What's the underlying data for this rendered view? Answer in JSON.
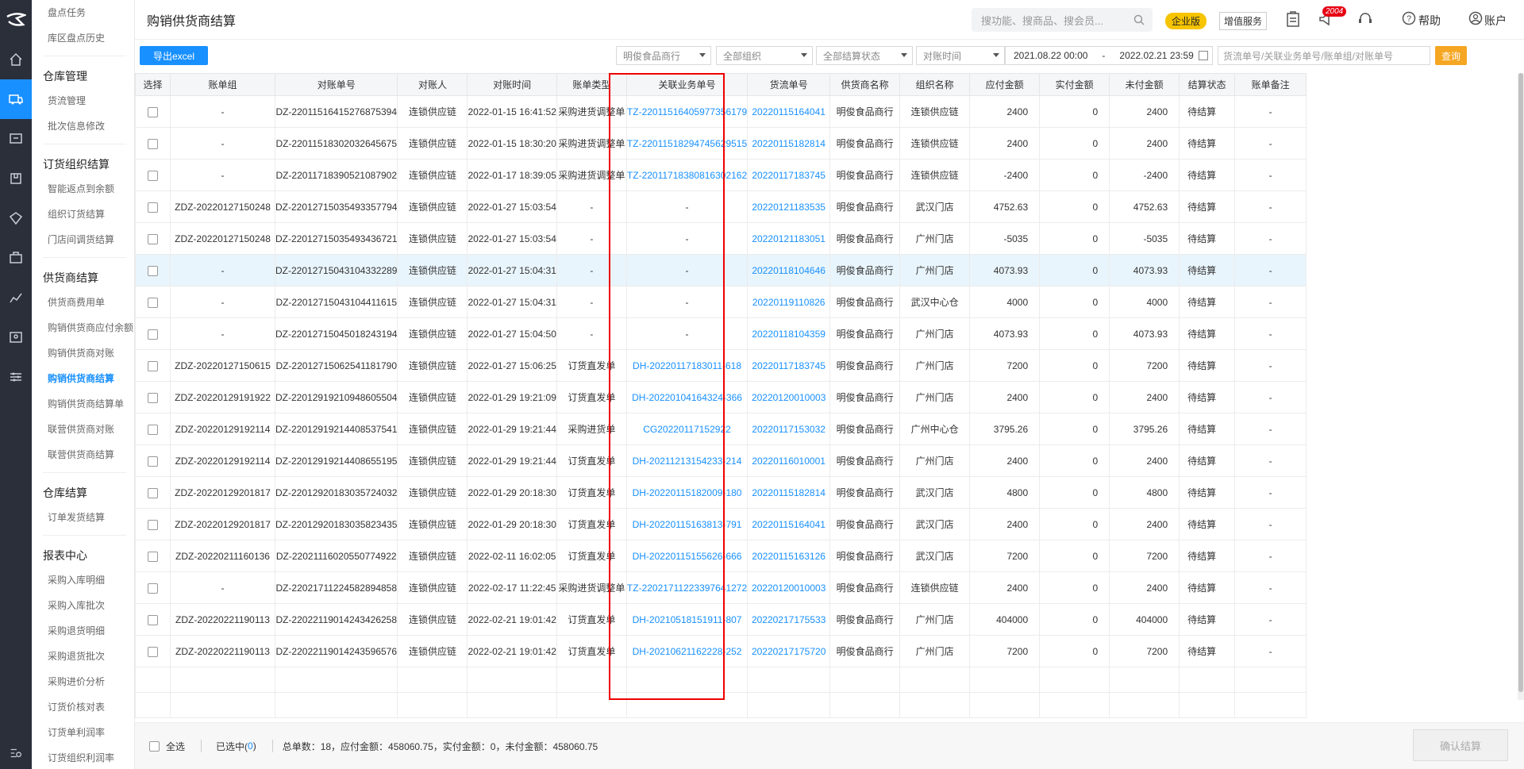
{
  "sidebar": {
    "items": [
      {
        "type": "item",
        "label": "盘点任务"
      },
      {
        "type": "item",
        "label": "库区盘点历史"
      },
      {
        "type": "group",
        "label": "仓库管理"
      },
      {
        "type": "item",
        "label": "货流管理"
      },
      {
        "type": "item",
        "label": "批次信息修改"
      },
      {
        "type": "group",
        "label": "订货组织结算"
      },
      {
        "type": "item",
        "label": "智能返点到余额"
      },
      {
        "type": "item",
        "label": "组织订货结算"
      },
      {
        "type": "item",
        "label": "门店间调货结算"
      },
      {
        "type": "group",
        "label": "供货商结算"
      },
      {
        "type": "item",
        "label": "供货商费用单"
      },
      {
        "type": "item",
        "label": "购销供货商应付余额",
        "wrap": true
      },
      {
        "type": "item",
        "label": "购销供货商对账"
      },
      {
        "type": "item",
        "label": "购销供货商结算",
        "active": true
      },
      {
        "type": "item",
        "label": "购销供货商结算单"
      },
      {
        "type": "item",
        "label": "联营供货商对账"
      },
      {
        "type": "item",
        "label": "联营供货商结算"
      },
      {
        "type": "group",
        "label": "仓库结算"
      },
      {
        "type": "item",
        "label": "订单发货结算"
      },
      {
        "type": "group",
        "label": "报表中心"
      },
      {
        "type": "item",
        "label": "采购入库明细"
      },
      {
        "type": "item",
        "label": "采购入库批次"
      },
      {
        "type": "item",
        "label": "采购退货明细"
      },
      {
        "type": "item",
        "label": "采购退货批次"
      },
      {
        "type": "item",
        "label": "采购进价分析"
      },
      {
        "type": "item",
        "label": "订货价核对表"
      },
      {
        "type": "item",
        "label": "订货单利润率"
      },
      {
        "type": "item",
        "label": "订货组织利润率"
      }
    ]
  },
  "header": {
    "title": "购销供货商结算",
    "search_placeholder": "搜功能、搜商品、搜会员...",
    "enterprise_badge": "企业版",
    "value_added": "增值服务",
    "notice_count": "2004",
    "help": "帮助",
    "account": "账户"
  },
  "toolbar": {
    "export": "导出excel",
    "supplier": "明俊食品商行",
    "org": "全部组织",
    "settle_status": "全部结算状态",
    "time_type": "对账时间",
    "date_from": "2021.08.22 00:00",
    "date_sep": "-",
    "date_to": "2022.02.21 23:59",
    "keyword_placeholder": "货流单号/关联业务单号/账单组/对账单号",
    "query": "查询"
  },
  "table": {
    "columns": [
      "选择",
      "账单组",
      "对账单号",
      "对账人",
      "对账时间",
      "账单类型",
      "关联业务单号",
      "货流单号",
      "供货商名称",
      "组织名称",
      "应付金额",
      "实付金额",
      "未付金额",
      "结算状态",
      "账单备注"
    ],
    "rows": [
      [
        "-",
        "DZ-22011516415276875394",
        "连锁供应链",
        "2022-01-15 16:41:52",
        "采购进货调整单",
        "TZ-22011516405977356179",
        "20220115164041",
        "明俊食品商行",
        "连锁供应链",
        "2400",
        "0",
        "2400",
        "待结算",
        "-"
      ],
      [
        "-",
        "DZ-22011518302032645675",
        "连锁供应链",
        "2022-01-15 18:30:20",
        "采购进货调整单",
        "TZ-22011518294745629515",
        "20220115182814",
        "明俊食品商行",
        "连锁供应链",
        "2400",
        "0",
        "2400",
        "待结算",
        "-"
      ],
      [
        "-",
        "DZ-22011718390521087902",
        "连锁供应链",
        "2022-01-17 18:39:05",
        "采购进货调整单",
        "TZ-22011718380816302162",
        "20220117183745",
        "明俊食品商行",
        "连锁供应链",
        "-2400",
        "0",
        "-2400",
        "待结算",
        "-"
      ],
      [
        "ZDZ-20220127150248",
        "DZ-22012715035493357794",
        "连锁供应链",
        "2022-01-27 15:03:54",
        "-",
        "-",
        "20220121183535",
        "明俊食品商行",
        "武汉门店",
        "4752.63",
        "0",
        "4752.63",
        "待结算",
        "-"
      ],
      [
        "ZDZ-20220127150248",
        "DZ-22012715035493436721",
        "连锁供应链",
        "2022-01-27 15:03:54",
        "-",
        "-",
        "20220121183051",
        "明俊食品商行",
        "广州门店",
        "-5035",
        "0",
        "-5035",
        "待结算",
        "-"
      ],
      [
        "-",
        "DZ-22012715043104332289",
        "连锁供应链",
        "2022-01-27 15:04:31",
        "-",
        "-",
        "20220118104646",
        "明俊食品商行",
        "广州门店",
        "4073.93",
        "0",
        "4073.93",
        "待结算",
        "-"
      ],
      [
        "-",
        "DZ-22012715043104411615",
        "连锁供应链",
        "2022-01-27 15:04:31",
        "-",
        "-",
        "20220119110826",
        "明俊食品商行",
        "武汉中心仓",
        "4000",
        "0",
        "4000",
        "待结算",
        "-"
      ],
      [
        "-",
        "DZ-22012715045018243194",
        "连锁供应链",
        "2022-01-27 15:04:50",
        "-",
        "-",
        "20220118104359",
        "明俊食品商行",
        "广州门店",
        "4073.93",
        "0",
        "4073.93",
        "待结算",
        "-"
      ],
      [
        "ZDZ-20220127150615",
        "DZ-22012715062541181790",
        "连锁供应链",
        "2022-01-27 15:06:25",
        "订货直发单",
        "DH-20220117183011-618",
        "20220117183745",
        "明俊食品商行",
        "广州门店",
        "7200",
        "0",
        "7200",
        "待结算",
        "-"
      ],
      [
        "ZDZ-20220129191922",
        "DZ-22012919210948605504",
        "连锁供应链",
        "2022-01-29 19:21:09",
        "订货直发单",
        "DH-20220104164324-366",
        "20220120010003",
        "明俊食品商行",
        "广州门店",
        "2400",
        "0",
        "2400",
        "待结算",
        "-"
      ],
      [
        "ZDZ-20220129192114",
        "DZ-22012919214408537541",
        "连锁供应链",
        "2022-01-29 19:21:44",
        "采购进货单",
        "CG20220117152922",
        "20220117153032",
        "明俊食品商行",
        "广州中心仓",
        "3795.26",
        "0",
        "3795.26",
        "待结算",
        "-"
      ],
      [
        "ZDZ-20220129192114",
        "DZ-22012919214408655195",
        "连锁供应链",
        "2022-01-29 19:21:44",
        "订货直发单",
        "DH-20211213154233-214",
        "20220116010001",
        "明俊食品商行",
        "广州门店",
        "2400",
        "0",
        "2400",
        "待结算",
        "-"
      ],
      [
        "ZDZ-20220129201817",
        "DZ-22012920183035724032",
        "连锁供应链",
        "2022-01-29 20:18:30",
        "订货直发单",
        "DH-20220115182009-180",
        "20220115182814",
        "明俊食品商行",
        "武汉门店",
        "4800",
        "0",
        "4800",
        "待结算",
        "-"
      ],
      [
        "ZDZ-20220129201817",
        "DZ-22012920183035823435",
        "连锁供应链",
        "2022-01-29 20:18:30",
        "订货直发单",
        "DH-20220115163813-791",
        "20220115164041",
        "明俊食品商行",
        "武汉门店",
        "2400",
        "0",
        "2400",
        "待结算",
        "-"
      ],
      [
        "ZDZ-20220211160136",
        "DZ-22021116020550774922",
        "连锁供应链",
        "2022-02-11 16:02:05",
        "订货直发单",
        "DH-20220115155626-666",
        "20220115163126",
        "明俊食品商行",
        "武汉门店",
        "7200",
        "0",
        "7200",
        "待结算",
        "-"
      ],
      [
        "-",
        "DZ-22021711224582894858",
        "连锁供应链",
        "2022-02-17 11:22:45",
        "采购进货调整单",
        "TZ-22021711223397641272",
        "20220120010003",
        "明俊食品商行",
        "连锁供应链",
        "2400",
        "0",
        "2400",
        "待结算",
        "-"
      ],
      [
        "ZDZ-20220221190113",
        "DZ-22022119014243426258",
        "连锁供应链",
        "2022-02-21 19:01:42",
        "订货直发单",
        "DH-20210518151911-807",
        "20220217175533",
        "明俊食品商行",
        "广州门店",
        "404000",
        "0",
        "404000",
        "待结算",
        "-"
      ],
      [
        "ZDZ-20220221190113",
        "DZ-22022119014243596576",
        "连锁供应链",
        "2022-02-21 19:01:42",
        "订货直发单",
        "DH-20210621162228-252",
        "20220217175720",
        "明俊食品商行",
        "广州门店",
        "7200",
        "0",
        "7200",
        "待结算",
        "-"
      ]
    ]
  },
  "footer": {
    "select_all": "全选",
    "selected_prefix": "已选中(",
    "selected_count": "0",
    "selected_suffix": ")",
    "summary": "总单数：18，应付金额：458060.75，实付金额：0，未付金额：458060.75",
    "confirm": "确认结算"
  },
  "colors": {
    "primary": "#1890ff",
    "query": "#f5a623",
    "highlight_box": "#e00000",
    "rail": "#2b2f3a"
  }
}
